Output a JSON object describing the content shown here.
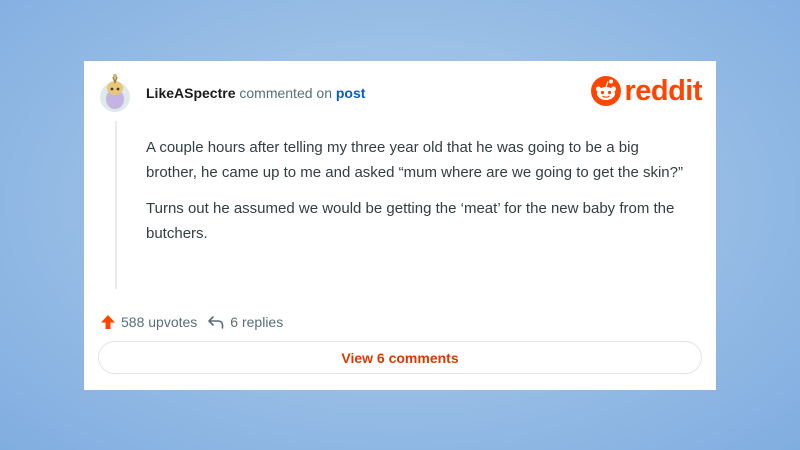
{
  "comment": {
    "username": "LikeASpectre",
    "action_text": "commented on",
    "post_link": "post",
    "paragraphs": [
      "A couple hours after telling my three year old that he was going to be a big brother, he came up to me and asked “mum where are we going to get the skin?”",
      "Turns out he assumed we would be getting the ‘meat’ for the new baby from the butchers."
    ]
  },
  "brand": {
    "logo_text": "reddit",
    "color": "#ff4500"
  },
  "stats": {
    "upvotes": "588 upvotes",
    "replies": "6 replies",
    "upvote_icon": "upvote-arrow-icon",
    "reply_icon": "reply-arrow-icon",
    "upvote_color": "#ff4500"
  },
  "view_comments_label": "View 6 comments"
}
